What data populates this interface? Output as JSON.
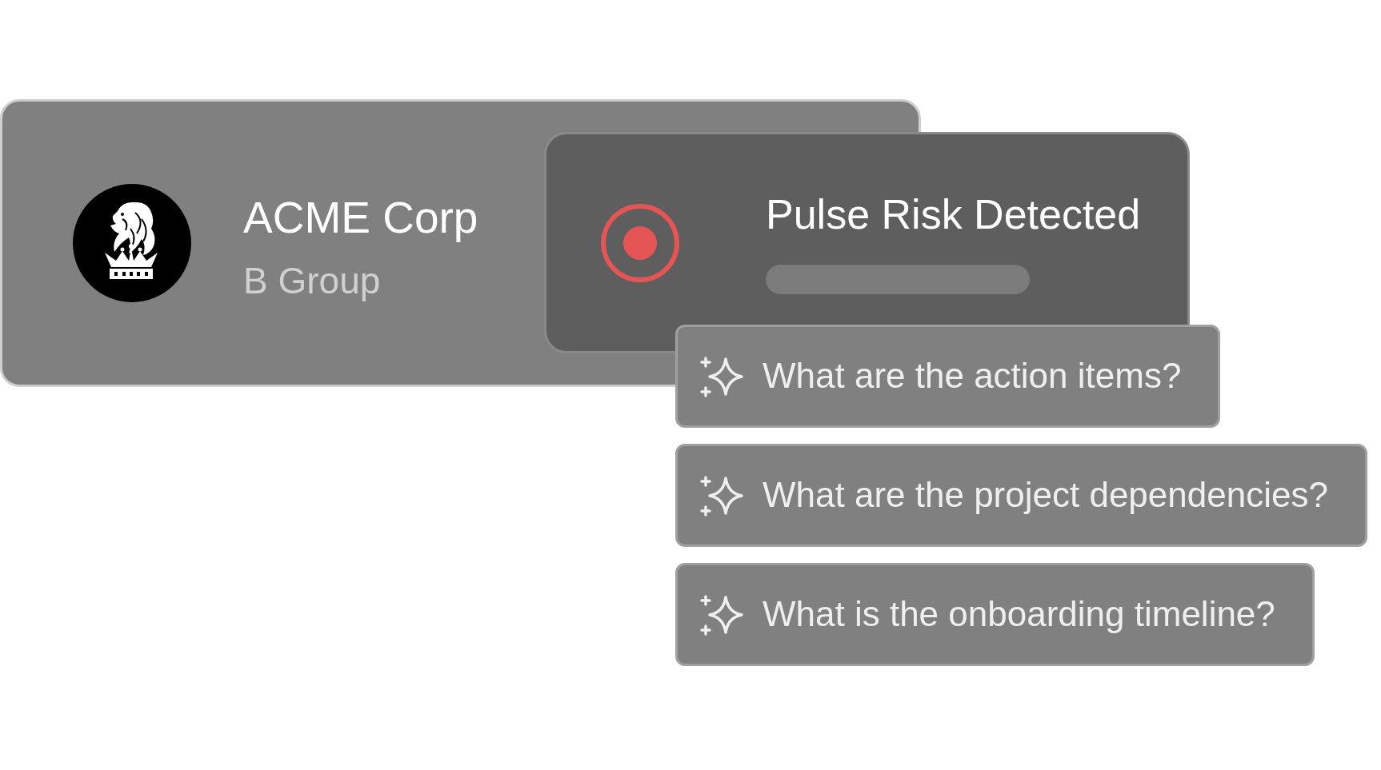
{
  "account": {
    "name": "ACME Corp",
    "group": "B Group"
  },
  "alert": {
    "title": "Pulse Risk Detected"
  },
  "suggestions": [
    "What are the action items?",
    "What are the project dependencies?",
    "What is the onboarding timeline?"
  ]
}
